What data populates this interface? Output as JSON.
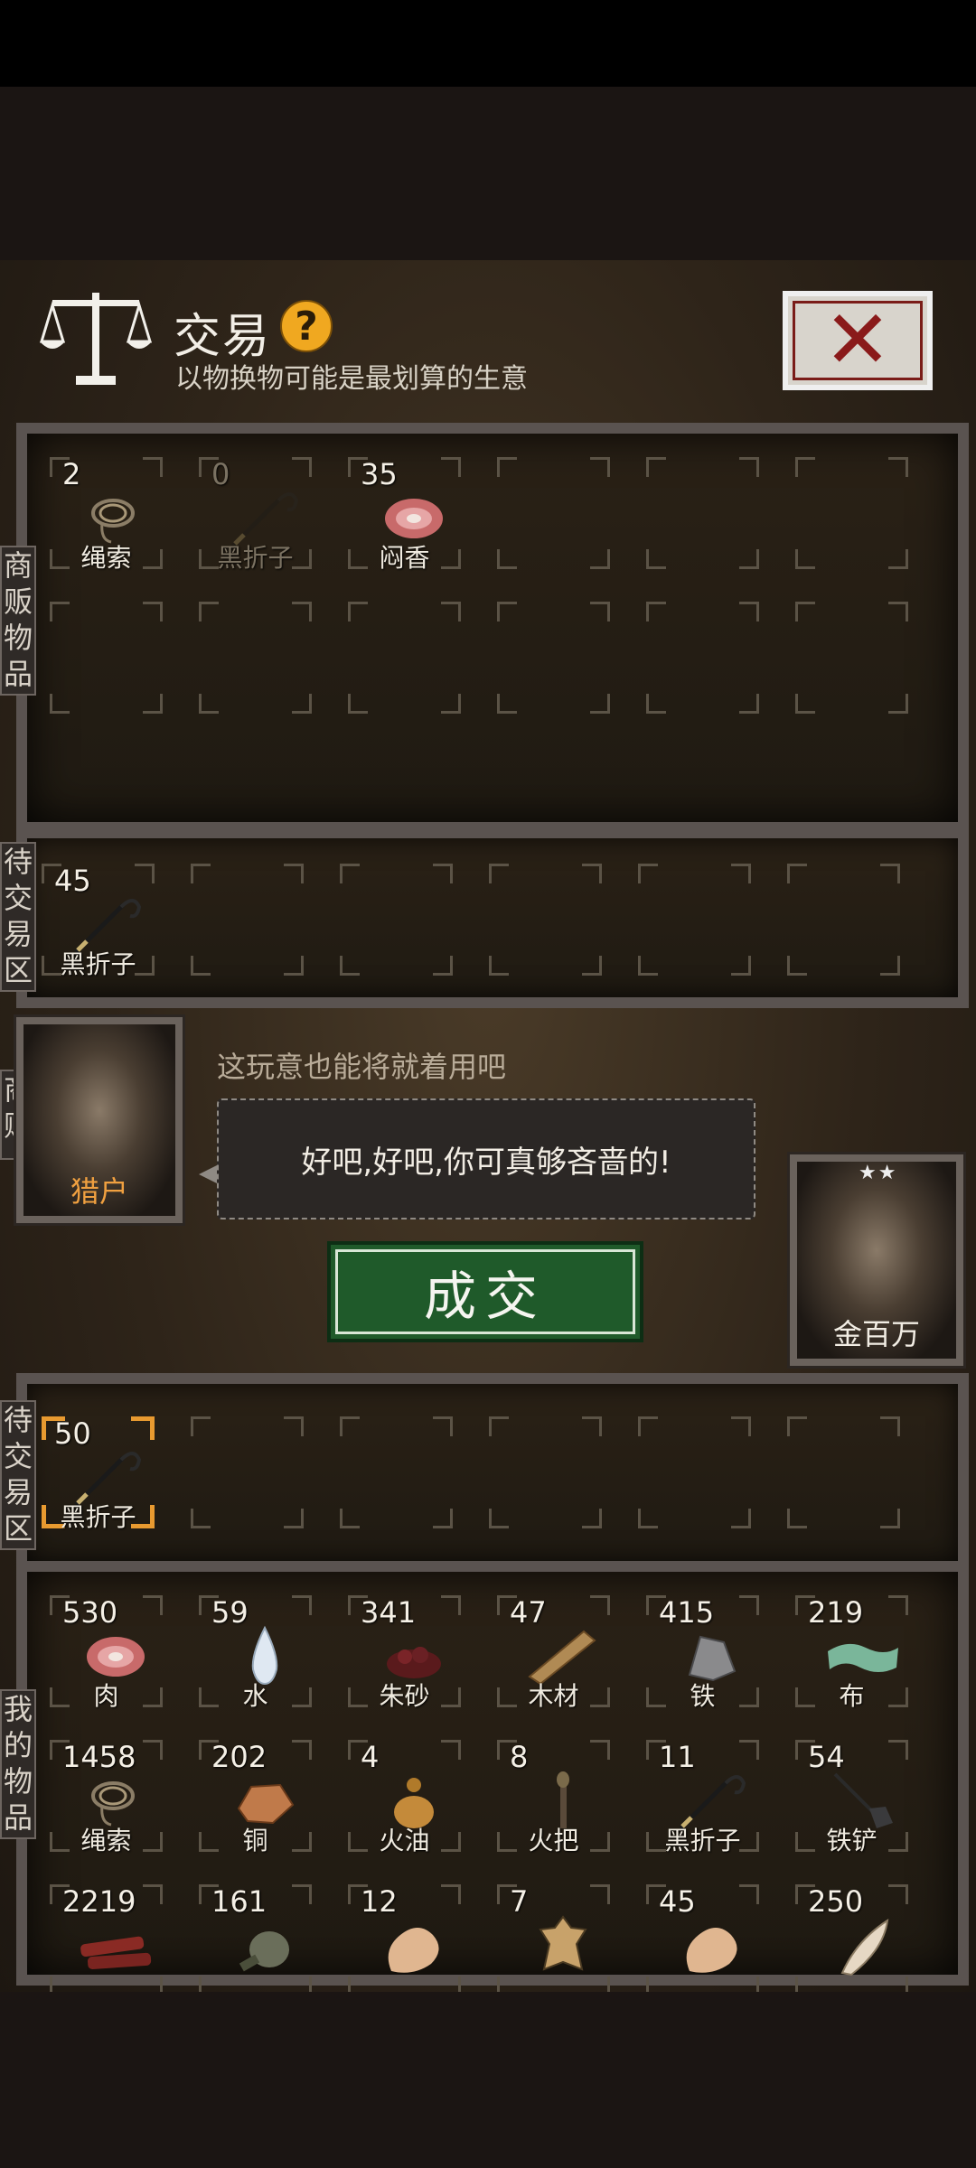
{
  "header": {
    "title": "交易",
    "help_icon": "question-mark",
    "subtitle": "以物换物可能是最划算的生意",
    "close_icon": "x"
  },
  "merchant_goods": {
    "side_label": "商贩物品",
    "items": [
      {
        "count": "2",
        "name": "绳索",
        "icon": "rope-icon",
        "dim": false
      },
      {
        "count": "0",
        "name": "黑折子",
        "icon": "hook-icon",
        "dim": true
      },
      {
        "count": "35",
        "name": "闷香",
        "icon": "meat-icon",
        "dim": false
      }
    ]
  },
  "merchant_pending": {
    "side_label": "待交易区",
    "items": [
      {
        "count": "45",
        "name": "黑折子",
        "icon": "hook-icon",
        "dim": false
      }
    ]
  },
  "merchant": {
    "side_label": "商贩",
    "name": "猎户",
    "quote": "这玩意也能将就着用吧"
  },
  "dialogue": {
    "reply": "好吧,好吧,你可真够吝啬的!"
  },
  "deal_button": {
    "label": "成交"
  },
  "player": {
    "name": "金百万",
    "stars": "★★"
  },
  "player_pending": {
    "side_label": "待交易区",
    "items": [
      {
        "count": "50",
        "name": "黑折子",
        "icon": "hook-icon",
        "dim": false,
        "selected": true
      }
    ]
  },
  "my_goods": {
    "side_label": "我的物品",
    "items": [
      {
        "count": "530",
        "name": "肉",
        "icon": "meat-icon"
      },
      {
        "count": "59",
        "name": "水",
        "icon": "water-drop-icon"
      },
      {
        "count": "341",
        "name": "朱砂",
        "icon": "cinnabar-icon"
      },
      {
        "count": "47",
        "name": "木材",
        "icon": "wood-plank-icon"
      },
      {
        "count": "415",
        "name": "铁",
        "icon": "iron-ore-icon"
      },
      {
        "count": "219",
        "name": "布",
        "icon": "cloth-icon"
      },
      {
        "count": "1458",
        "name": "绳索",
        "icon": "rope-icon"
      },
      {
        "count": "202",
        "name": "铜",
        "icon": "copper-ore-icon"
      },
      {
        "count": "4",
        "name": "火油",
        "icon": "oil-gourd-icon"
      },
      {
        "count": "8",
        "name": "火把",
        "icon": "torch-icon"
      },
      {
        "count": "11",
        "name": "黑折子",
        "icon": "hook-icon"
      },
      {
        "count": "54",
        "name": "铁铲",
        "icon": "shovel-icon"
      },
      {
        "count": "2219",
        "name": "",
        "icon": "jerky-icon"
      },
      {
        "count": "161",
        "name": "",
        "icon": "flask-icon"
      },
      {
        "count": "12",
        "name": "",
        "icon": "hide-icon"
      },
      {
        "count": "7",
        "name": "",
        "icon": "tiger-pelt-icon"
      },
      {
        "count": "45",
        "name": "",
        "icon": "hide-icon"
      },
      {
        "count": "250",
        "name": "",
        "icon": "fang-icon"
      }
    ]
  },
  "colors": {
    "accent_gold": "#f0a820",
    "deal_green": "#1f5a2a",
    "selected_orange": "#e89a30",
    "close_red": "#8a1a1a"
  }
}
